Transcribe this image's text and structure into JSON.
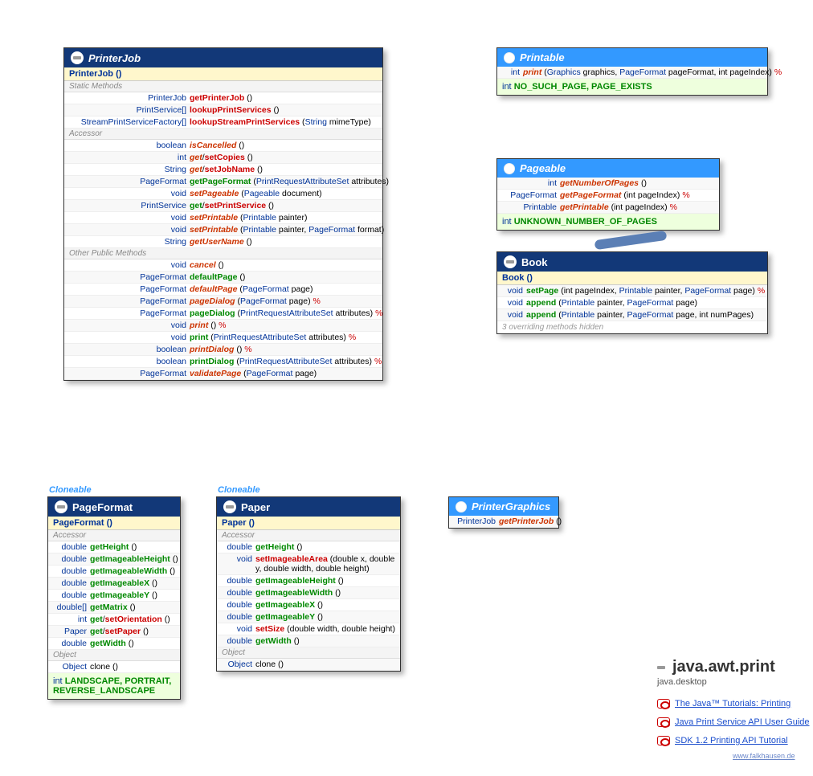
{
  "printerJob": {
    "title": "PrinterJob",
    "ctor": "PrinterJob ()",
    "sections": [
      {
        "label": "Static Methods",
        "rows": [
          {
            "ret": "PrinterJob",
            "m": "getPrinterJob",
            "cls": "method",
            "args": " ()"
          },
          {
            "ret": "PrintService[]",
            "m": "lookupPrintServices",
            "cls": "method",
            "args": " ()"
          },
          {
            "ret": "StreamPrintServiceFactory[]",
            "m": "lookupStreamPrintServices",
            "cls": "method",
            "args": " (String mimeType)"
          }
        ]
      },
      {
        "label": "Accessor",
        "rows": [
          {
            "ret": "boolean",
            "m": "isCancelled",
            "cls": "method abs",
            "args": " ()"
          },
          {
            "ret": "int",
            "m": "get",
            "m2": "setCopies",
            "cls": "method abs",
            "args": " ()"
          },
          {
            "ret": "String",
            "m": "get",
            "m2": "setJobName",
            "cls": "method abs",
            "args": " ()"
          },
          {
            "ret": "PageFormat",
            "m": "getPageFormat",
            "cls": "method reg",
            "args": " (PrintRequestAttributeSet attributes)"
          },
          {
            "ret": "void",
            "m": "setPageable",
            "cls": "method abs",
            "args": " (Pageable document)"
          },
          {
            "ret": "PrintService",
            "m": "get",
            "m2": "setPrintService",
            "cls": "method reg",
            "args": " ()"
          },
          {
            "ret": "void",
            "m": "setPrintable",
            "cls": "method abs",
            "args": " (Printable painter)"
          },
          {
            "ret": "void",
            "m": "setPrintable",
            "cls": "method abs",
            "args": " (Printable painter, PageFormat format)"
          },
          {
            "ret": "String",
            "m": "getUserName",
            "cls": "method abs",
            "args": " ()"
          }
        ]
      },
      {
        "label": "Other Public Methods",
        "rows": [
          {
            "ret": "void",
            "m": "cancel",
            "cls": "method abs",
            "args": " ()"
          },
          {
            "ret": "PageFormat",
            "m": "defaultPage",
            "cls": "method reg",
            "args": " ()"
          },
          {
            "ret": "PageFormat",
            "m": "defaultPage",
            "cls": "method abs",
            "args": " (PageFormat page)"
          },
          {
            "ret": "PageFormat",
            "m": "pageDialog",
            "cls": "method abs",
            "args": " (PageFormat page) ",
            "mark": "%"
          },
          {
            "ret": "PageFormat",
            "m": "pageDialog",
            "cls": "method reg",
            "args": " (PrintRequestAttributeSet attributes) ",
            "mark": "%"
          },
          {
            "ret": "void",
            "m": "print",
            "cls": "method abs",
            "args": " () ",
            "mark": "%"
          },
          {
            "ret": "void",
            "m": "print",
            "cls": "method reg",
            "args": " (PrintRequestAttributeSet attributes) ",
            "mark": "%"
          },
          {
            "ret": "boolean",
            "m": "printDialog",
            "cls": "method abs",
            "args": " () ",
            "mark": "%"
          },
          {
            "ret": "boolean",
            "m": "printDialog",
            "cls": "method reg",
            "args": " (PrintRequestAttributeSet attributes) ",
            "mark": "%"
          },
          {
            "ret": "PageFormat",
            "m": "validatePage",
            "cls": "method abs",
            "args": " (PageFormat page)"
          }
        ]
      }
    ],
    "retWidth": "150px"
  },
  "printable": {
    "title": "Printable",
    "rows": [
      {
        "ret": "int",
        "m": "print",
        "cls": "method abs",
        "args": " (Graphics graphics, PageFormat pageFormat, int pageIndex) ",
        "mark": "%"
      }
    ],
    "consts": "NO_SUCH_PAGE, PAGE_EXISTS",
    "constsPrefix": "int",
    "retWidth": "26px"
  },
  "pageable": {
    "title": "Pageable",
    "rows": [
      {
        "ret": "int",
        "m": "getNumberOfPages",
        "cls": "method abs",
        "args": " ()"
      },
      {
        "ret": "PageFormat",
        "m": "getPageFormat",
        "cls": "method abs",
        "args": " (int pageIndex) ",
        "mark": "%"
      },
      {
        "ret": "Printable",
        "m": "getPrintable",
        "cls": "method abs",
        "args": " (int pageIndex) ",
        "mark": "%"
      }
    ],
    "consts": "UNKNOWN_NUMBER_OF_PAGES",
    "constsPrefix": "int",
    "retWidth": "72px"
  },
  "book": {
    "title": "Book",
    "ctor": "Book ()",
    "rows": [
      {
        "ret": "void",
        "m": "setPage",
        "cls": "method reg",
        "args": " (int pageIndex, Printable painter, PageFormat page) ",
        "mark": "%"
      },
      {
        "ret": "void",
        "m": "append",
        "cls": "method reg",
        "args": " (Printable painter, PageFormat page)"
      },
      {
        "ret": "void",
        "m": "append",
        "cls": "method reg",
        "args": " (Printable painter, PageFormat page, int numPages)"
      }
    ],
    "hidden": "3 overriding methods hidden",
    "retWidth": "30px"
  },
  "pageFormat": {
    "title": "PageFormat",
    "ctor": "PageFormat ()",
    "stereotype": "Cloneable",
    "sections": [
      {
        "label": "Accessor",
        "rows": [
          {
            "ret": "double",
            "m": "getHeight",
            "cls": "method get",
            "args": " ()"
          },
          {
            "ret": "double",
            "m": "getImageableHeight",
            "cls": "method get",
            "args": " ()"
          },
          {
            "ret": "double",
            "m": "getImageableWidth",
            "cls": "method get",
            "args": " ()"
          },
          {
            "ret": "double",
            "m": "getImageableX",
            "cls": "method get",
            "args": " ()"
          },
          {
            "ret": "double",
            "m": "getImageableY",
            "cls": "method get",
            "args": " ()"
          },
          {
            "ret": "double[]",
            "m": "getMatrix",
            "cls": "method get",
            "args": " ()"
          },
          {
            "ret": "int",
            "m": "get",
            "m2": "setOrientation",
            "cls": "method get",
            "args": " ()"
          },
          {
            "ret": "Paper",
            "m": "get",
            "m2": "setPaper",
            "cls": "method get",
            "args": " ()"
          },
          {
            "ret": "double",
            "m": "getWidth",
            "cls": "method get",
            "args": " ()"
          }
        ]
      },
      {
        "label": "Object",
        "rows": [
          {
            "ret": "Object",
            "m": "clone",
            "cls": "plain",
            "args": " ()"
          }
        ]
      }
    ],
    "consts": "LANDSCAPE, PORTRAIT, REVERSE_LANDSCAPE",
    "constsPrefix": "int",
    "retWidth": "46px"
  },
  "paper": {
    "title": "Paper",
    "ctor": "Paper ()",
    "stereotype": "Cloneable",
    "sections": [
      {
        "label": "Accessor",
        "rows": [
          {
            "ret": "double",
            "m": "getHeight",
            "cls": "method get",
            "args": " ()"
          },
          {
            "ret": "void",
            "m": "setImageableArea",
            "cls": "method set",
            "args": " (double x, double y, double width, double height)",
            "wrap": true
          },
          {
            "ret": "double",
            "m": "getImageableHeight",
            "cls": "method get",
            "args": " ()"
          },
          {
            "ret": "double",
            "m": "getImageableWidth",
            "cls": "method get",
            "args": " ()"
          },
          {
            "ret": "double",
            "m": "getImageableX",
            "cls": "method get",
            "args": " ()"
          },
          {
            "ret": "double",
            "m": "getImageableY",
            "cls": "method get",
            "args": " ()"
          },
          {
            "ret": "void",
            "m": "setSize",
            "cls": "method set",
            "args": " (double width, double height)"
          },
          {
            "ret": "double",
            "m": "getWidth",
            "cls": "method get",
            "args": " ()"
          }
        ]
      },
      {
        "label": "Object",
        "rows": [
          {
            "ret": "Object",
            "m": "clone",
            "cls": "plain",
            "args": " ()"
          }
        ]
      }
    ],
    "retWidth": "42px"
  },
  "printerGraphics": {
    "title": "PrinterGraphics",
    "rows": [
      {
        "ret": "PrinterJob",
        "m": "getPrinterJob",
        "cls": "method abs",
        "args": " ()"
      }
    ],
    "retWidth": "56px"
  },
  "pkg": {
    "title": "java.awt.print",
    "sub": "java.desktop"
  },
  "links": [
    "The Java™ Tutorials: Printing",
    "Java Print Service API User Guide",
    "SDK 1.2 Printing API Tutorial"
  ],
  "credit": "www.falkhausen.de"
}
